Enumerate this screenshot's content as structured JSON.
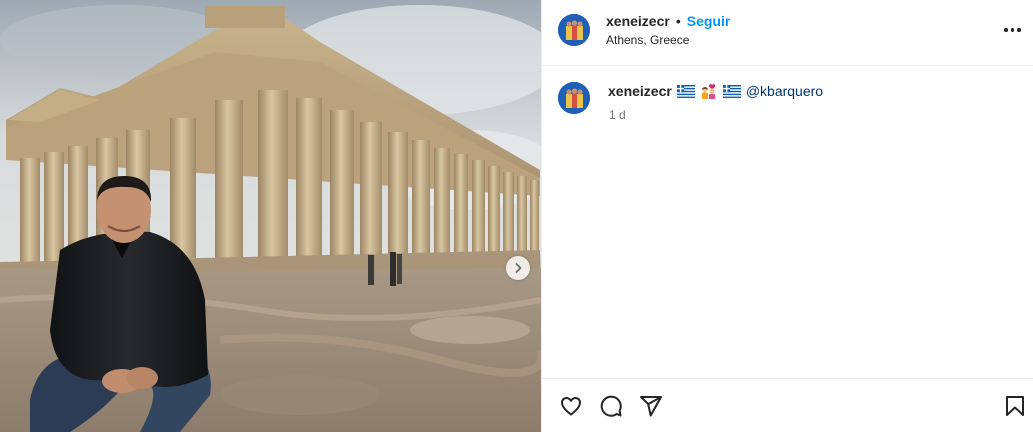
{
  "post": {
    "username": "xeneizecr",
    "separator": "•",
    "follow_label": "Seguir",
    "location": "Athens, Greece",
    "more_icon": "more-horizontal-icon"
  },
  "caption": {
    "username": "xeneizecr",
    "flags": [
      "greece-flag",
      "couple-emoji",
      "greece-flag"
    ],
    "mention": "@kbarquero",
    "time": "1 d"
  },
  "media": {
    "description_icon": "photo",
    "next_icon": "chevron-right-icon"
  },
  "actions": {
    "like_icon": "heart-icon",
    "comment_icon": "comment-icon",
    "share_icon": "share-icon",
    "save_icon": "bookmark-icon"
  },
  "colors": {
    "accent": "#0095f6",
    "mention": "#00376b",
    "muted": "#737373",
    "divider": "#efefef"
  }
}
